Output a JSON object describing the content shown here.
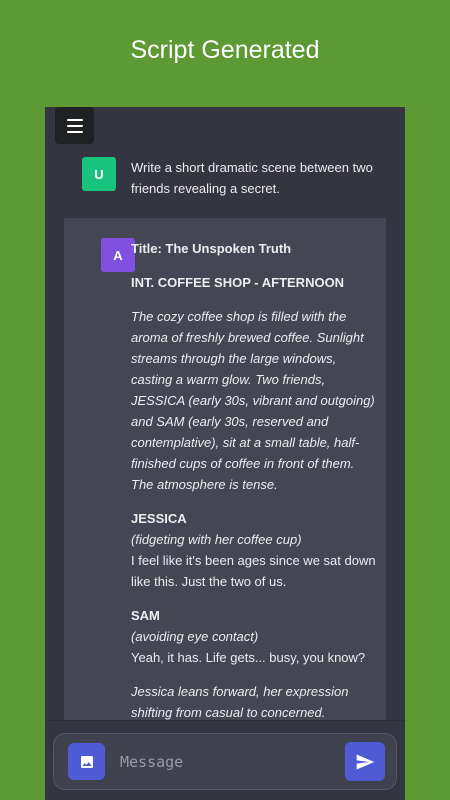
{
  "banner": {
    "title": "Script Generated"
  },
  "colors": {
    "background": "#5e9a34",
    "app_bg": "#343541",
    "assistant_bg": "#444654",
    "user_avatar": "#19c37d",
    "assistant_avatar": "#8150e0",
    "accent_button": "#4f5bd5"
  },
  "header": {
    "menu_icon": "hamburger-menu-icon"
  },
  "conversation": {
    "user": {
      "avatar_letter": "U",
      "text": "Write a short dramatic scene between two friends revealing a secret."
    },
    "assistant": {
      "avatar_letter": "A",
      "title": "Title: The Unspoken Truth",
      "scene_heading": "INT. COFFEE SHOP - AFTERNOON",
      "description": "The cozy coffee shop is filled with the aroma of freshly brewed coffee. Sunlight streams through the large windows, casting a warm glow. Two friends, JESSICA (early 30s, vibrant and outgoing) and SAM (early 30s, reserved and contemplative), sit at a small table, half-finished cups of coffee in front of them. The atmosphere is tense.",
      "lines": [
        {
          "character": "JESSICA",
          "parenthetical": "(fidgeting with her coffee cup)",
          "dialogue": "I feel like it's been ages since we sat down like this. Just the two of us."
        },
        {
          "character": "SAM",
          "parenthetical": "(avoiding eye contact)",
          "dialogue": "Yeah, it has. Life gets... busy, you know?"
        }
      ],
      "action": "Jessica leans forward, her expression shifting from casual to concerned."
    }
  },
  "composer": {
    "placeholder": "Message",
    "image_icon": "image-icon",
    "send_icon": "send-icon"
  }
}
